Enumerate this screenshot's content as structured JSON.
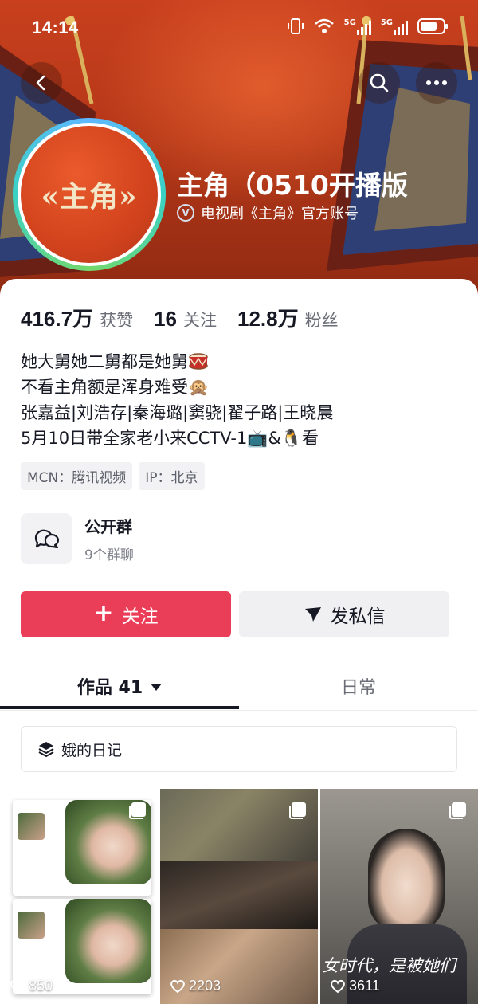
{
  "status_bar": {
    "time": "14:14",
    "network_label_1": "5G",
    "network_label_2": "5G"
  },
  "header": {
    "account_name": "主角（0510开播版",
    "verification_text": "电视剧《主角》官方账号",
    "avatar_text": "«主角»"
  },
  "stats": [
    {
      "value": "416.7万",
      "label": "获赞"
    },
    {
      "value": "16",
      "label": "关注"
    },
    {
      "value": "12.8万",
      "label": "粉丝"
    }
  ],
  "bio": {
    "line1": "她大舅她二舅都是她舅",
    "line2": "不看主角额是浑身难受🙊",
    "line3": "张嘉益|刘浩存|秦海璐|窦骁|翟子路|王晓晨",
    "line4_part1": "5月10日带全家老小来CCTV-1",
    "line4_part2": "📺&🐧",
    "line4_part3": "看"
  },
  "tags": {
    "mcn": "MCN：腾讯视频",
    "ip": "IP：北京"
  },
  "group": {
    "title": "公开群",
    "subtitle": "9个群聊"
  },
  "actions": {
    "follow_label": "关注",
    "message_label": "发私信"
  },
  "tabs": {
    "works_label": "作品 41",
    "daily_label": "日常"
  },
  "collection": {
    "label": "娥的日记"
  },
  "videos": [
    {
      "likes": "850"
    },
    {
      "likes": "2203"
    },
    {
      "likes": "3611",
      "subtitle": "女时代，是被她们"
    }
  ],
  "colors": {
    "follow_button": "#ea3d57",
    "banner": "#c8401e",
    "text_primary": "#161823",
    "text_secondary": "#6b6d77"
  },
  "icons": {
    "back": "chevron-left-icon",
    "search": "search-icon",
    "more": "more-icon",
    "verified": "verified-icon",
    "group": "chat-bubbles-icon",
    "message": "paper-plane-icon",
    "collection": "layers-icon",
    "likes": "heart-icon",
    "multi": "multi-image-icon"
  }
}
